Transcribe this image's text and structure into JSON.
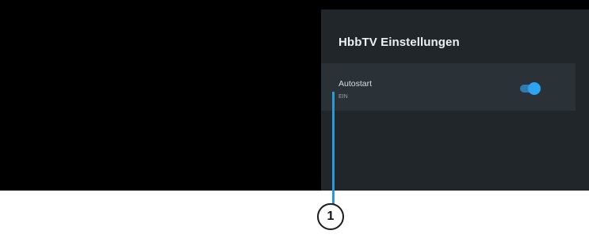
{
  "panel": {
    "title": "HbbTV Einstellungen",
    "setting": {
      "label": "Autostart",
      "value": "EIN",
      "toggle_on": true
    }
  },
  "callout": {
    "number": "1"
  },
  "colors": {
    "screen": "#000000",
    "panel": "#20262a",
    "row_highlight": "#2b3237",
    "toggle_accent": "#2ea3f2",
    "callout_line": "#2a9ad6"
  }
}
